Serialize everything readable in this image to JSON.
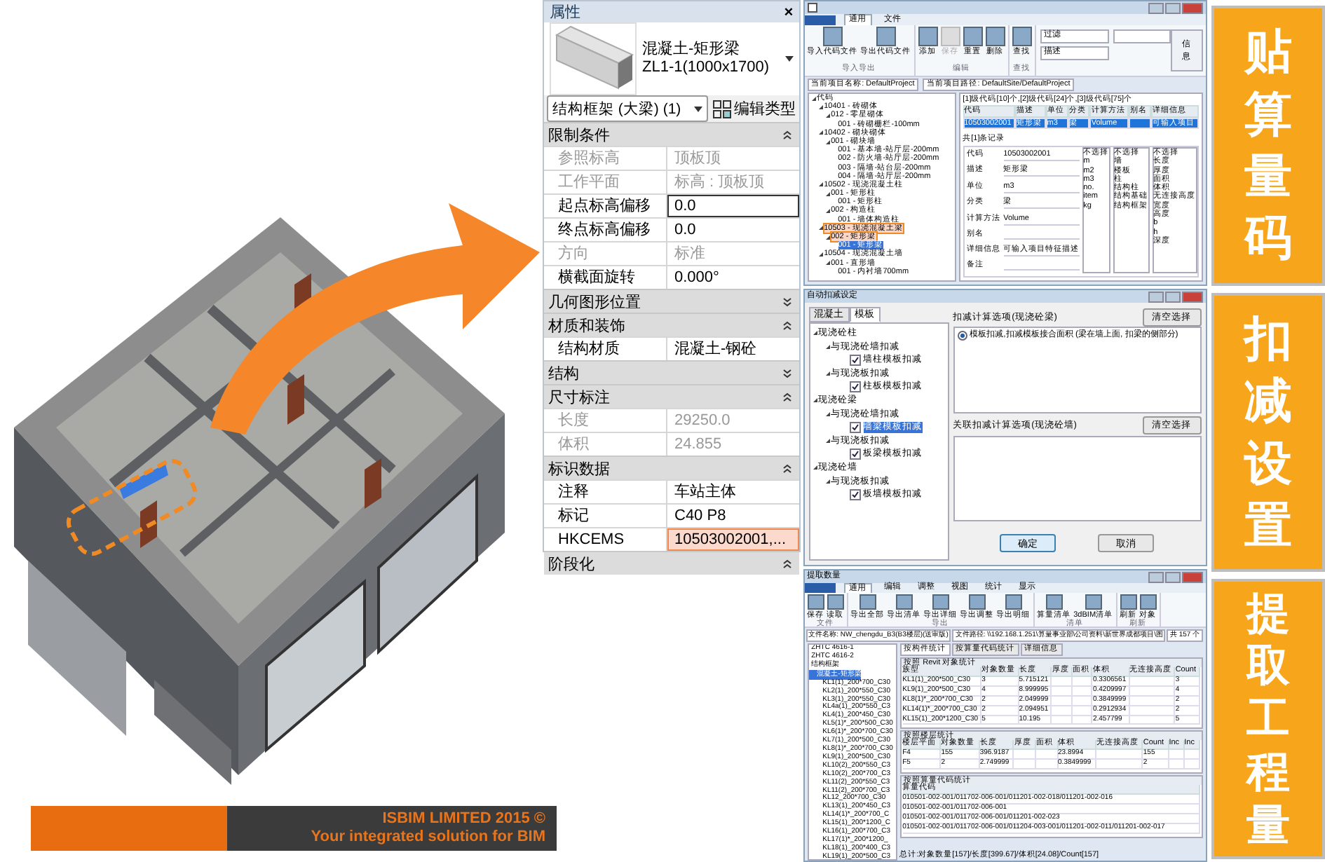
{
  "properties_panel": {
    "title": "属性",
    "close": "×",
    "type_name": "混凝土-矩形梁",
    "type_size": "ZL1-1(1000x1700)",
    "selector": "结构框架 (大梁) (1)",
    "edit_type": "编辑类型",
    "sections": [
      {
        "name": "限制条件",
        "expanded": true,
        "rows": [
          {
            "label": "参照标高",
            "value": "顶板顶",
            "disabled": true,
            "focused": false,
            "highlighted": false
          },
          {
            "label": "工作平面",
            "value": "标高 : 顶板顶",
            "disabled": true,
            "focused": false,
            "highlighted": false
          },
          {
            "label": "起点标高偏移",
            "value": "0.0",
            "disabled": false,
            "focused": true,
            "highlighted": false
          },
          {
            "label": "终点标高偏移",
            "value": "0.0",
            "disabled": false,
            "focused": false,
            "highlighted": false
          },
          {
            "label": "方向",
            "value": "标准",
            "disabled": true,
            "focused": false,
            "highlighted": false
          },
          {
            "label": "横截面旋转",
            "value": "0.000°",
            "disabled": false,
            "focused": false,
            "highlighted": false
          }
        ]
      },
      {
        "name": "几何图形位置",
        "expanded": false
      },
      {
        "name": "材质和装饰",
        "expanded": true,
        "rows": [
          {
            "label": "结构材质",
            "value": "混凝土-钢砼",
            "disabled": false,
            "focused": false,
            "highlighted": false
          }
        ]
      },
      {
        "name": "结构",
        "expanded": false
      },
      {
        "name": "尺寸标注",
        "expanded": true,
        "rows": [
          {
            "label": "长度",
            "value": "29250.0",
            "disabled": true,
            "focused": false,
            "highlighted": false
          },
          {
            "label": "体积",
            "value": "24.855",
            "disabled": true,
            "focused": false,
            "highlighted": false
          }
        ]
      },
      {
        "name": "标识数据",
        "expanded": true,
        "rows": [
          {
            "label": "注释",
            "value": "车站主体",
            "disabled": false,
            "focused": false,
            "highlighted": false
          },
          {
            "label": "标记",
            "value": "C40 P8",
            "disabled": false,
            "focused": false,
            "highlighted": false
          },
          {
            "label": "HKCEMS",
            "value": "10503002001,...",
            "disabled": false,
            "focused": false,
            "highlighted": true
          }
        ]
      },
      {
        "name": "阶段化",
        "expanded": true
      }
    ]
  },
  "code_window": {
    "tabs": [
      {
        "label": "通用",
        "selected": true
      },
      {
        "label": "文件",
        "selected": false
      }
    ],
    "ribbon_groups": [
      {
        "name": "导入导出",
        "buttons": [
          {
            "label": "导入代码文件",
            "disabled": false
          },
          {
            "label": "导出代码文件",
            "disabled": false
          }
        ]
      },
      {
        "name": "编辑",
        "buttons": [
          {
            "label": "添加",
            "disabled": false
          },
          {
            "label": "保存",
            "disabled": true
          },
          {
            "label": "重置",
            "disabled": false
          },
          {
            "label": "删除",
            "disabled": false
          }
        ]
      },
      {
        "name": "查找",
        "buttons": [
          {
            "label": "查找",
            "disabled": false
          }
        ]
      }
    ],
    "filters": [
      "过滤",
      "描述"
    ],
    "info_button": "信息",
    "paths": [
      "当前项目名称: DefaultProject",
      "当前项目路径: DefaultSite/DefaultProject"
    ],
    "tree": [
      {
        "label": "代码",
        "selected": false,
        "highlighted": false,
        "children": [
          {
            "label": "10401 - 砖砌体",
            "selected": false,
            "highlighted": false,
            "children": [
              {
                "label": "012 - 零星砌体",
                "selected": false,
                "highlighted": false,
                "children": [
                  {
                    "label": "001 - 砖砌栅栏-100mm",
                    "selected": false,
                    "highlighted": false
                  }
                ]
              }
            ]
          },
          {
            "label": "10402 - 砌块砌体",
            "selected": false,
            "highlighted": false,
            "children": [
              {
                "label": "001 - 砌块墙",
                "selected": false,
                "highlighted": false,
                "children": [
                  {
                    "label": "001 - 基本墙-站厅层-200mm",
                    "selected": false,
                    "highlighted": false
                  },
                  {
                    "label": "002 - 防火墙-站厅层-200mm",
                    "selected": false,
                    "highlighted": false
                  },
                  {
                    "label": "003 - 隔墙-站台层-200mm",
                    "selected": false,
                    "highlighted": false
                  },
                  {
                    "label": "004 - 隔墙-站厅层-200mm",
                    "selected": false,
                    "highlighted": false
                  }
                ]
              }
            ]
          },
          {
            "label": "10502 - 现浇混凝土柱",
            "selected": false,
            "highlighted": false,
            "children": [
              {
                "label": "001 - 矩形柱",
                "selected": false,
                "highlighted": false,
                "children": [
                  {
                    "label": "001 - 矩形柱",
                    "selected": false,
                    "highlighted": false
                  }
                ]
              },
              {
                "label": "002 - 构造柱",
                "selected": false,
                "highlighted": false,
                "children": [
                  {
                    "label": "001 - 墙体构造柱",
                    "selected": false,
                    "highlighted": false
                  }
                ]
              }
            ]
          },
          {
            "label": "10503 - 现浇混凝土梁",
            "selected": false,
            "highlighted": true,
            "children": [
              {
                "label": "002 - 矩形梁",
                "selected": false,
                "highlighted": true,
                "children": [
                  {
                    "label": "001 - 矩形梁",
                    "selected": true,
                    "highlighted": false
                  }
                ]
              }
            ]
          },
          {
            "label": "10504 - 现浇混凝土墙",
            "selected": false,
            "highlighted": false,
            "children": [
              {
                "label": "001 - 直形墙",
                "selected": false,
                "highlighted": false,
                "children": [
                  {
                    "label": "001 - 内衬墙700mm",
                    "selected": false,
                    "highlighted": false
                  }
                ]
              }
            ]
          }
        ]
      }
    ],
    "summary": "[1]级代码[10]个,[2]级代码[24]个,[3]级代码[75]个",
    "columns": [
      "代码",
      "描述",
      "单位",
      "分类",
      "计算方法",
      "别名",
      "详细信息"
    ],
    "rows": [
      {
        "cells": [
          "10503002001",
          "矩形梁",
          "m3",
          "梁",
          "Volume",
          null,
          "可输入项目"
        ],
        "selected": true
      }
    ],
    "record_count": "共[1]条记录",
    "form": [
      {
        "label": "代码",
        "value": "10503002001"
      },
      {
        "label": "描述",
        "value": "矩形梁"
      },
      {
        "label": "单位",
        "value": "m3"
      },
      {
        "label": "分类",
        "value": "梁"
      },
      {
        "label": "计算方法",
        "value": "Volume"
      },
      {
        "label": "别名"
      },
      {
        "label": "详细信息",
        "value": "可输入项目特征描述"
      },
      {
        "label": "备注"
      }
    ],
    "lists": [
      [
        "不选择",
        "m",
        "m2",
        "m3",
        "no.",
        "item",
        "kg"
      ],
      [
        "不选择",
        "墙",
        "楼板",
        "柱",
        "结构柱",
        "结构基础",
        "结构框架"
      ],
      [
        "不选择",
        "长度",
        "厚度",
        "面积",
        "体积",
        "无连接高度",
        "宽度",
        "高度",
        "b",
        "h",
        "深度"
      ]
    ]
  },
  "deduct_window": {
    "title": "自动扣减设定",
    "tabs": [
      {
        "label": "混凝土",
        "selected": false
      },
      {
        "label": "模板",
        "selected": true
      }
    ],
    "tree": [
      {
        "kind": "node",
        "label": "现浇砼柱",
        "children": [
          {
            "kind": "node",
            "label": "与现浇砼墙扣减",
            "children": [
              {
                "kind": "checkbox",
                "label": "墙柱模板扣减",
                "checked": true,
                "selected": false
              }
            ]
          },
          {
            "kind": "node",
            "label": "与现浇板扣减",
            "children": [
              {
                "kind": "checkbox",
                "label": "柱板模板扣减",
                "checked": true,
                "selected": false
              }
            ]
          }
        ]
      },
      {
        "kind": "node",
        "label": "现浇砼梁",
        "children": [
          {
            "kind": "node",
            "label": "与现浇砼墙扣减",
            "children": [
              {
                "kind": "checkbox",
                "label": "墙梁模板扣减",
                "checked": true,
                "selected": true
              }
            ]
          },
          {
            "kind": "node",
            "label": "与现浇板扣减",
            "children": [
              {
                "kind": "checkbox",
                "label": "板梁模板扣减",
                "checked": true,
                "selected": false
              }
            ]
          }
        ]
      },
      {
        "kind": "node",
        "label": "现浇砼墙",
        "children": [
          {
            "kind": "node",
            "label": "与现浇板扣减",
            "children": [
              {
                "kind": "checkbox",
                "label": "板墙模板扣减",
                "checked": true,
                "selected": false
              }
            ]
          }
        ]
      }
    ],
    "option_panels": [
      {
        "heading": "扣减计算选项(现浇砼梁)",
        "clear": "清空选择",
        "options": [
          {
            "label": "模板扣减,扣减模板接合面积 (梁在墙上面, 扣梁的侧部分)",
            "selected": true
          }
        ]
      },
      {
        "heading": "关联扣减计算选项(现浇砼墙)",
        "clear": "清空选择"
      }
    ],
    "ok": "确定",
    "cancel": "取消"
  },
  "extract_window": {
    "title": "提取数量",
    "tabs": [
      {
        "label": "通用",
        "selected": true
      },
      {
        "label": "编辑",
        "selected": false
      },
      {
        "label": "调整",
        "selected": false
      },
      {
        "label": "视图",
        "selected": false
      },
      {
        "label": "统计",
        "selected": false
      },
      {
        "label": "显示",
        "selected": false
      }
    ],
    "ribbon_groups": [
      {
        "name": "文件",
        "buttons": [
          "保存",
          "读取"
        ]
      },
      {
        "name": "导出",
        "buttons": [
          "导出全部",
          "导出清单",
          "导出详细",
          "导出调整",
          "导出明细"
        ]
      },
      {
        "name": "清单",
        "buttons": [
          "算量清单",
          "3dBIM清单"
        ]
      },
      {
        "name": "刷新",
        "buttons": [
          "刷新",
          "对象"
        ]
      }
    ],
    "file_name": "文件名称: NW_chengdu_B3(B3楼层)(送审版)",
    "file_path": "文件路径: \\\\192.168.1.251\\算量事业部\\公司资料\\新世界成都项目\\图",
    "file_count": "共 157 个",
    "tree": [
      {
        "label": "ZHTC 4616-1",
        "selected": false
      },
      {
        "label": "ZHTC 4616-2",
        "selected": false
      },
      {
        "label": "结构框架",
        "selected": false,
        "children": [
          {
            "label": "混凝土-矩形梁",
            "selected": true,
            "children": [
              {
                "label": "KL1(1)_200*700_C30",
                "selected": false
              },
              {
                "label": "KL2(1)_200*550_C30",
                "selected": false
              },
              {
                "label": "KL3(1)_200*550_C30",
                "selected": false
              },
              {
                "label": "KL4a(1)_200*550_C3",
                "selected": false
              },
              {
                "label": "KL4(1)_200*450_C30",
                "selected": false
              },
              {
                "label": "KL5(1)*_200*500_C30",
                "selected": false
              },
              {
                "label": "KL6(1)*_200*700_C30",
                "selected": false
              },
              {
                "label": "KL7(1)_200*500_C30",
                "selected": false
              },
              {
                "label": "KL8(1)*_200*700_C30",
                "selected": false
              },
              {
                "label": "KL9(1)_200*500_C30",
                "selected": false
              },
              {
                "label": "KL10(2)_200*550_C3",
                "selected": false
              },
              {
                "label": "KL10(2)_200*700_C3",
                "selected": false
              },
              {
                "label": "KL11(2)_200*550_C3",
                "selected": false
              },
              {
                "label": "KL11(2)_200*700_C3",
                "selected": false
              },
              {
                "label": "KL12_200*700_C30",
                "selected": false
              },
              {
                "label": "KL13(1)_200*450_C3",
                "selected": false
              },
              {
                "label": "KL14(1)*_200*700_C",
                "selected": false
              },
              {
                "label": "KL15(1)_200*1200_C",
                "selected": false
              },
              {
                "label": "KL16(1)_200*700_C3",
                "selected": false
              },
              {
                "label": "KL17(1)*_200*1200_",
                "selected": false
              },
              {
                "label": "KL18(1)_200*400_C3",
                "selected": false
              },
              {
                "label": "KL19(1)_200*500_C3",
                "selected": false
              }
            ]
          }
        ]
      }
    ],
    "view_tabs": [
      {
        "label": "按构件统计",
        "selected": true
      },
      {
        "label": "按算量代码统计",
        "selected": false
      },
      {
        "label": "详细信息",
        "selected": false
      }
    ],
    "tables": [
      {
        "title": "按照 Revit 对象统计",
        "columns": [
          "族型",
          "对象数量",
          "长度",
          "厚度",
          "面积",
          "体积",
          "无连接高度",
          "Count"
        ],
        "rows": [
          [
            "KL1(1)_200*500_C30",
            "3",
            "5.715121",
            null,
            null,
            "0.3306561",
            null,
            "3"
          ],
          [
            "KL9(1)_200*500_C30",
            "4",
            "8.999995",
            null,
            null,
            "0.4209997",
            null,
            "4"
          ],
          [
            "KL8(1)*_200*700_C30",
            "2",
            "2.049999",
            null,
            null,
            "0.3849999",
            null,
            "2"
          ],
          [
            "KL14(1)*_200*700_C30",
            "2",
            "2.094951",
            null,
            null,
            "0.2912934",
            null,
            "2"
          ],
          [
            "KL15(1)_200*1200_C30",
            "5",
            "10.195",
            null,
            null,
            "2.457799",
            null,
            "5"
          ]
        ]
      },
      {
        "title": "按照楼层统计",
        "columns": [
          "楼层平面",
          "对象数量",
          "长度",
          "厚度",
          "面积",
          "体积",
          "无连接高度",
          "Count",
          "Inc",
          "Inc"
        ],
        "rows": [
          [
            "F4",
            "155",
            "396.9187",
            null,
            null,
            "23.8994",
            null,
            "155",
            null,
            null
          ],
          [
            "F5",
            "2",
            "2.749999",
            null,
            null,
            "0.3849999",
            null,
            "2",
            null,
            null
          ]
        ]
      },
      {
        "title": "按照算量代码统计",
        "columns": [
          "算量代码"
        ],
        "rows": [
          [
            "010501-002-001/011702-006-001/011201-002-018/011201-002-016"
          ],
          [
            "010501-002-001/011702-006-001"
          ],
          [
            "010501-002-001/011702-006-001/011201-002-023"
          ],
          [
            "010501-002-001/011702-006-001/011204-003-001/011201-002-011/011201-002-017"
          ]
        ]
      }
    ],
    "status": "总计:对象数量[157]/长度[399.67]/体积[24.08]/Count[157]"
  },
  "step_labels": [
    "贴算量码",
    "扣减设置",
    "提取工程量"
  ],
  "banner": {
    "line1": "ISBIM LIMITED 2015 ©",
    "line2": "Your integrated solution for BIM"
  }
}
